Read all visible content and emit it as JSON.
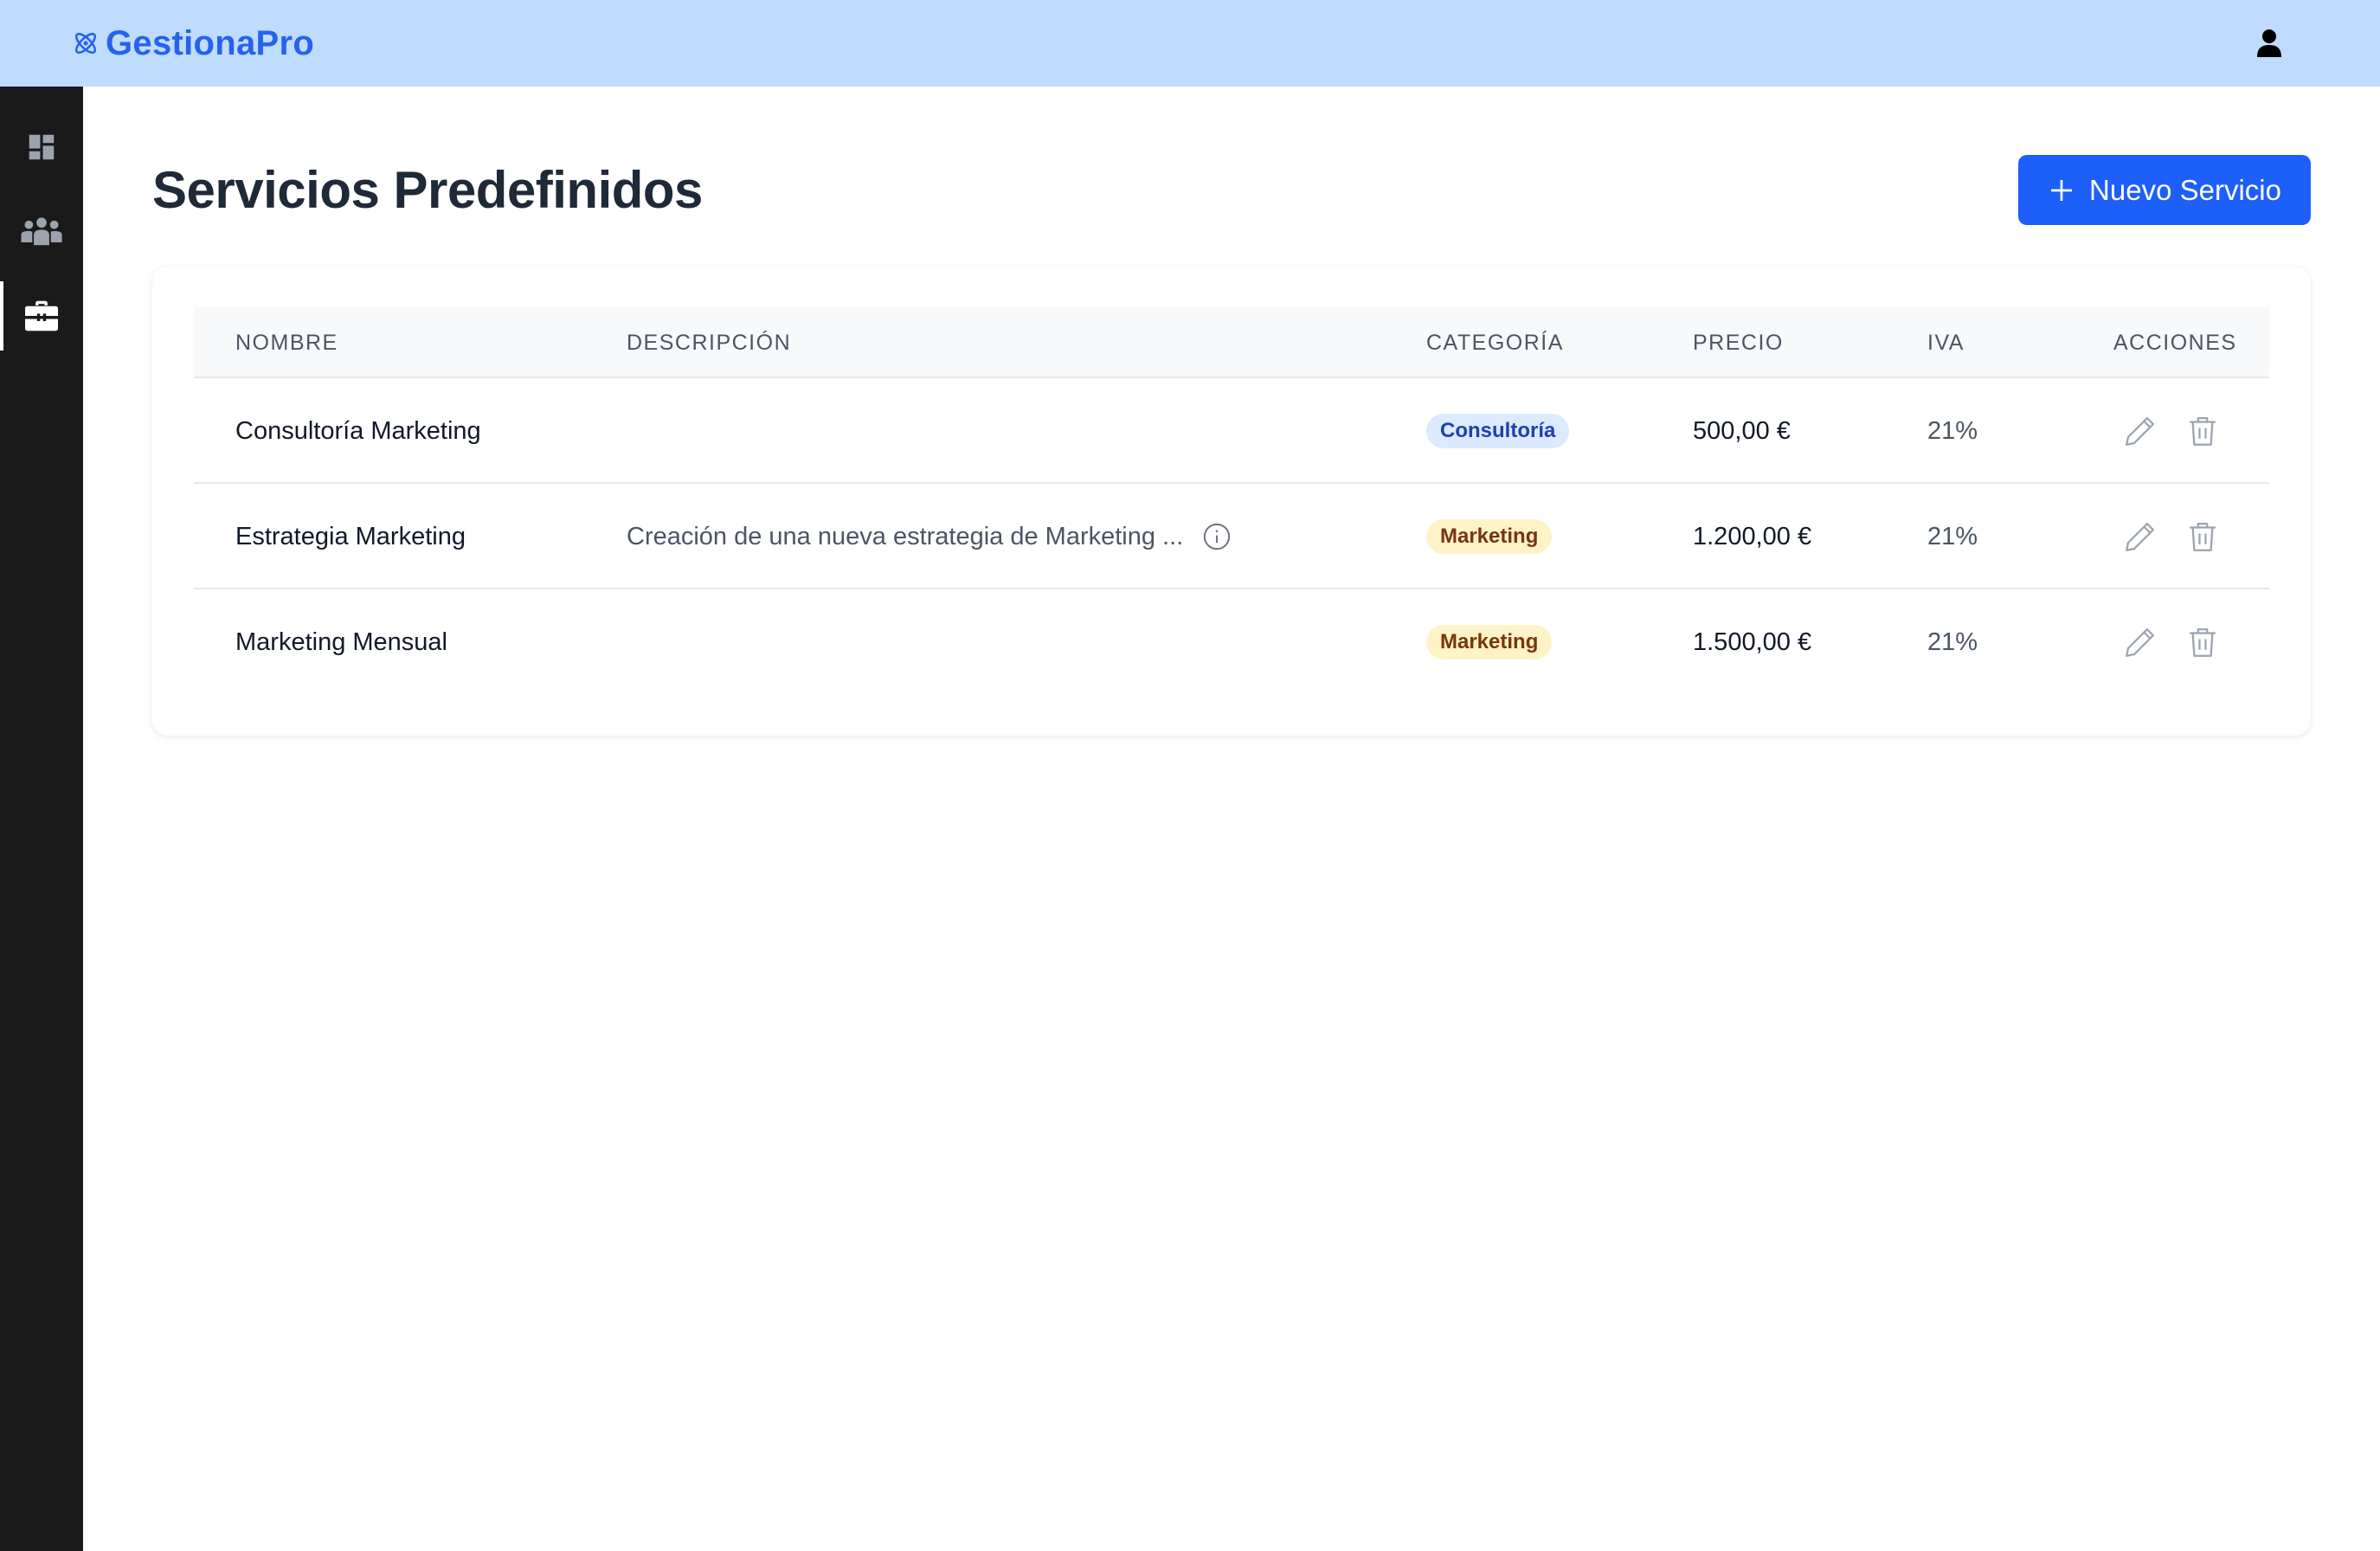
{
  "header": {
    "brand": "GestionaPro",
    "brand_color": "#2563eb",
    "bar_color": "#bfdbfe",
    "brand_icon": "atom-icon",
    "user_icon": "user-icon"
  },
  "sidebar": {
    "items": [
      {
        "name": "dashboard",
        "icon": "dashboard-icon",
        "active": false
      },
      {
        "name": "clients",
        "icon": "users-group-icon",
        "active": false
      },
      {
        "name": "services",
        "icon": "toolbox-icon",
        "active": true
      }
    ]
  },
  "main": {
    "title": "Servicios Predefinidos",
    "new_button": {
      "label": "Nuevo Servicio",
      "icon": "plus-icon",
      "color": "#1d5ffa"
    }
  },
  "table": {
    "columns": [
      "NOMBRE",
      "DESCRIPCIÓN",
      "CATEGORÍA",
      "PRECIO",
      "IVA",
      "ACCIONES"
    ],
    "rows": [
      {
        "nombre": "Consultoría Marketing",
        "descripcion": "",
        "categoria": "Consultoría",
        "precio": "500,00 €",
        "iva": "21%"
      },
      {
        "nombre": "Estrategia Marketing",
        "descripcion": "Creación de una nueva estrategia de Marketing ...",
        "categoria": "Marketing",
        "precio": "1.200,00 €",
        "iva": "21%"
      },
      {
        "nombre": "Marketing Mensual",
        "descripcion": "",
        "categoria": "Marketing",
        "precio": "1.500,00 €",
        "iva": "21%"
      }
    ],
    "badge_colors": {
      "Consultoría": {
        "bg": "#dbeafe",
        "fg": "#1e40af"
      },
      "Marketing": {
        "bg": "#fef3c7",
        "fg": "#78350f"
      }
    },
    "action_icons": [
      "pencil-icon",
      "trash-icon"
    ]
  }
}
